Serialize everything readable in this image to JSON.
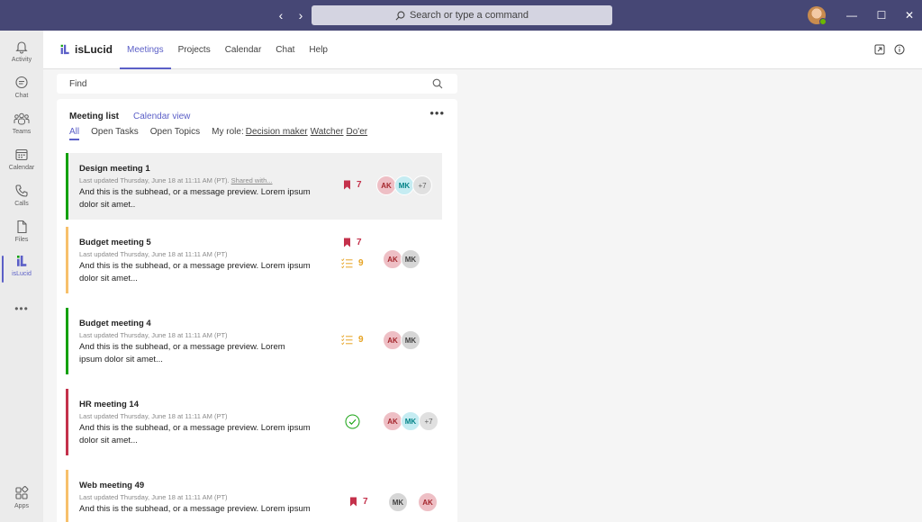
{
  "titlebar": {
    "back_glyph": "‹",
    "forward_glyph": "›",
    "search_placeholder": "Search or type a command",
    "minimize_glyph": "—",
    "maximize_glyph": "☐",
    "close_glyph": "✕",
    "accent_color": "#464775"
  },
  "rail": {
    "items": [
      {
        "label": "Activity",
        "icon": "bell-icon"
      },
      {
        "label": "Chat",
        "icon": "chat-icon"
      },
      {
        "label": "Teams",
        "icon": "teams-icon"
      },
      {
        "label": "Calendar",
        "icon": "calendar-icon"
      },
      {
        "label": "Calls",
        "icon": "phone-icon"
      },
      {
        "label": "Files",
        "icon": "file-icon"
      },
      {
        "label": "isLucid",
        "icon": "islucid-logo-icon"
      }
    ],
    "more": "•••",
    "apps_label": "Apps"
  },
  "app": {
    "name": "isLucid",
    "tabs": [
      "Meetings",
      "Projects",
      "Calendar",
      "Chat",
      "Help"
    ],
    "active_tab": "Meetings",
    "accent_color": "#5b5fc7"
  },
  "find": {
    "placeholder": "Find"
  },
  "panel": {
    "title": "Meeting list",
    "calendar_view": "Calendar view",
    "more": "•••",
    "filters": [
      "All",
      "Open Tasks",
      "Open Topics"
    ],
    "role_label": "My role:",
    "roles": [
      "Decision maker",
      "Watcher",
      "Do'er"
    ]
  },
  "meetings": [
    {
      "title": "Design meeting 1",
      "meta": "Last updated Thursday, June 18 at 11:11 AM (PT).",
      "shared": "Shared with...",
      "preview": "And this is the subhead, or a message preview. Lorem ipsum dolor sit amet..",
      "bar_color": "#13a10e",
      "bookmarks": "7",
      "tasks": "",
      "avatars": [
        "AK",
        "MK",
        "+7"
      ]
    },
    {
      "title": "Budget meeting 5",
      "meta": "Last updated Thursday, June 18 at 11:11 AM (PT)",
      "shared": "",
      "preview": "And this is the subhead, or a message preview. Lorem ipsum dolor sit amet...",
      "bar_color": "#f7c06b",
      "bookmarks": "7",
      "tasks": "9",
      "avatars": [
        "AK",
        "MK"
      ]
    },
    {
      "title": "Budget meeting 4",
      "meta": "Last updated Thursday, June 18 at 11:11 AM (PT)",
      "shared": "",
      "preview": "And this is the subhead, or a message preview. Lorem ipsum dolor sit amet...",
      "bar_color": "#13a10e",
      "bookmarks": "",
      "tasks": "9",
      "avatars": [
        "AK",
        "MK"
      ]
    },
    {
      "title": "HR meeting 14",
      "meta": "Last updated Thursday, June 18 at 11:11 AM (PT)",
      "shared": "",
      "preview": "And this is the subhead, or a message preview. Lorem ipsum dolor sit amet...",
      "bar_color": "#c4314b",
      "bookmarks": "",
      "tasks": "",
      "avatars": [
        "AK",
        "MK",
        "+7"
      ]
    },
    {
      "title": "Web meeting 49",
      "meta": "Last updated Thursday, June 18 at 11:11 AM (PT)",
      "shared": "",
      "preview": "And this is the subhead, or a message preview. Lorem ipsum",
      "bar_color": "#f7c06b",
      "bookmarks": "7",
      "tasks": "",
      "avatars": [
        "MK",
        "AK"
      ]
    }
  ]
}
